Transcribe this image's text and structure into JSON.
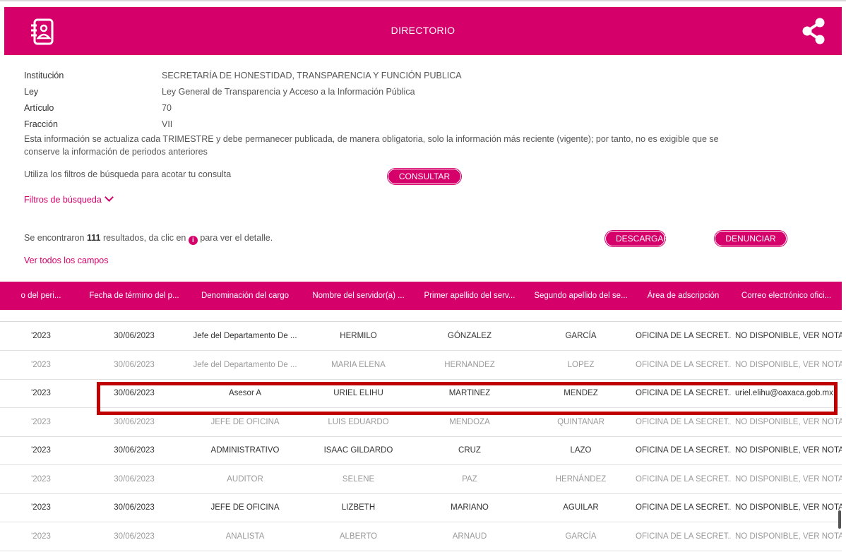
{
  "header": {
    "title": "DIRECTORIO"
  },
  "info": {
    "institucion_label": "Institución",
    "institucion_value": "SECRETARÍA DE HONESTIDAD, TRANSPARENCIA Y FUNCIÓN PUBLICA",
    "ley_label": "Ley",
    "ley_value": "Ley General de Transparencia y Acceso a la Información Pública",
    "articulo_label": "Artículo",
    "articulo_value": "70",
    "fraccion_label": "Fracción",
    "fraccion_value": "VII",
    "notice_line1": "Esta información se actualiza cada TRIMESTRE y debe permanecer publicada, de manera obligatoria, solo la información más reciente (vigente); por tanto, no es exigible que se",
    "notice_line2": "conserve la información de periodos anteriores"
  },
  "filters": {
    "hint": "Utiliza los filtros de búsqueda para acotar tu consulta",
    "consultar": "CONSULTAR",
    "toggle_label": "Filtros de búsqueda"
  },
  "results": {
    "prefix": "Se encontraron",
    "count": "111",
    "middle": "resultados, da clic en",
    "suffix": "para ver el detalle.",
    "descargar": "DESCARGAR",
    "denunciar": "DENUNCIAR",
    "ver_todos": "Ver todos los campos"
  },
  "table": {
    "headers": [
      "o del peri...",
      "Fecha de término del p...",
      "Denominación del cargo",
      "Nombre del servidor(a) ...",
      "Primer apellido del serv...",
      "Segundo apellido del se...",
      "Área de adscripción",
      "Correo electrónico ofici..."
    ],
    "rows": [
      [
        "'2023",
        "30/06/2023",
        "Jefe del Departamento De ...",
        "HERMILO",
        "GÓNZALEZ",
        "GARCÍA",
        "OFICINA DE LA SECRET...",
        "NO DISPONIBLE, VER NOTA"
      ],
      [
        "'2023",
        "30/06/2023",
        "Jefe del Departamento De ...",
        "MARIA ELENA",
        "HERNANDEZ",
        "LOPEZ",
        "OFICINA DE LA SECRET...",
        "NO DISPONIBLE, VER NOTA"
      ],
      [
        "'2023",
        "30/06/2023",
        "Asesor A",
        "URIEL ELIHU",
        "MARTINEZ",
        "MENDEZ",
        "OFICINA DE LA SECRET...",
        "uriel.elihu@oaxaca.gob.mx"
      ],
      [
        "'2023",
        "30/06/2023",
        "JEFE DE OFICINA",
        "LUIS EDUARDO",
        "MENDOZA",
        "QUINTANAR",
        "OFICINA DE LA SECRET...",
        "NO DISPONIBLE, VER NOTA"
      ],
      [
        "'2023",
        "30/06/2023",
        "ADMINISTRATIVO",
        "ISAAC GILDARDO",
        "CRUZ",
        "LAZO",
        "OFICINA DE LA SECRET...",
        "NO DISPONIBLE, VER NOTA"
      ],
      [
        "'2023",
        "30/06/2023",
        "AUDITOR",
        "SELENE",
        "PAZ",
        "HERNÁNDEZ",
        "OFICINA DE LA SECRET...",
        "NO DISPONIBLE, VER NOTA"
      ],
      [
        "'2023",
        "30/06/2023",
        "JEFE DE OFICINA",
        "LIZBETH",
        "MARIANO",
        "AGUILAR",
        "OFICINA DE LA SECRET...",
        "NO DISPONIBLE, VER NOTA"
      ],
      [
        "'2023",
        "30/06/2023",
        "ANALISTA",
        "ALBERTO",
        "ARNAUD",
        "GARCÍA",
        "OFICINA DE LA SECRET...",
        "NO DISPONIBLE, VER NOTA"
      ]
    ]
  },
  "colors": {
    "accent": "#d6006b",
    "highlight": "#c00000"
  }
}
